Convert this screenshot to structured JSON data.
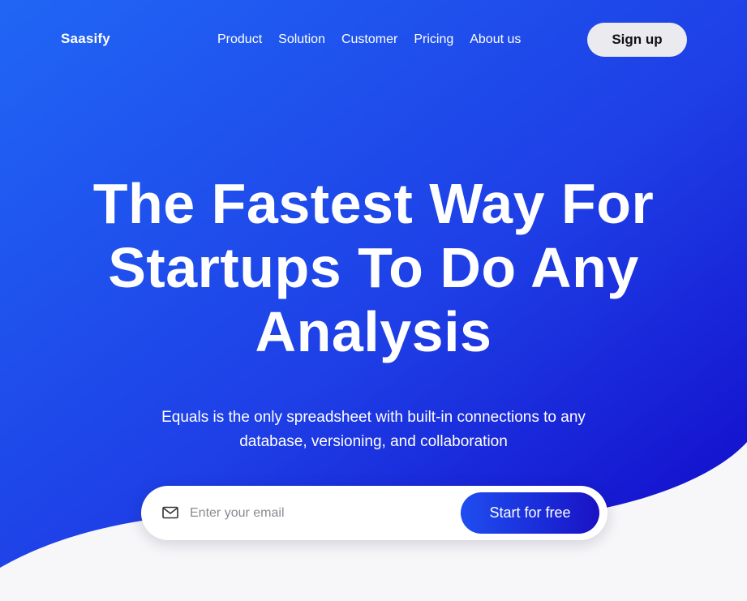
{
  "nav": {
    "logo": "Saasify",
    "items": [
      {
        "label": "Product"
      },
      {
        "label": "Solution"
      },
      {
        "label": "Customer"
      },
      {
        "label": "Pricing"
      },
      {
        "label": "About us"
      }
    ],
    "signup_label": "Sign up"
  },
  "hero": {
    "headline_line1": "The Fastest Way For",
    "headline_line2": "Startups To Do Any",
    "headline_line3": "Analysis",
    "subtitle_line1": "Equals is the only spreadsheet with built-in connections to any",
    "subtitle_line2": "database, versioning, and collaboration"
  },
  "signup_form": {
    "email_placeholder": "Enter your email",
    "email_value": "",
    "submit_label": "Start for free",
    "icon": "mail-icon"
  },
  "colors": {
    "gradient_start": "#2066f5",
    "gradient_end": "#1208c8",
    "page_background": "#f7f7f9"
  }
}
